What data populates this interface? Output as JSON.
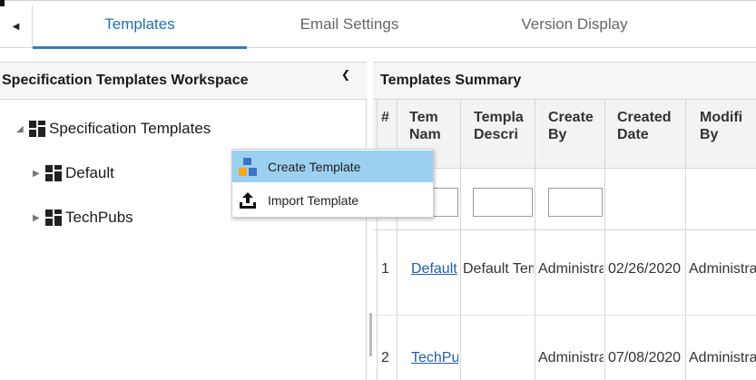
{
  "tabs": [
    {
      "label": "Templates",
      "active": true
    },
    {
      "label": "Email Settings",
      "active": false
    },
    {
      "label": "Version Display",
      "active": false
    }
  ],
  "left_panel": {
    "title": "Specification Templates Workspace",
    "tree": {
      "root": {
        "label": "Specification Templates",
        "expanded": true
      },
      "children": [
        {
          "label": "Default",
          "expanded": false
        },
        {
          "label": "TechPubs",
          "expanded": false
        }
      ]
    }
  },
  "context_menu": {
    "items": [
      {
        "label": "Create Template",
        "icon": "create-template-icon",
        "highlighted": true
      },
      {
        "label": "Import Template",
        "icon": "import-icon",
        "highlighted": false
      }
    ]
  },
  "right_panel": {
    "title": "Templates Summary",
    "columns": [
      {
        "line1": "#",
        "line2": ""
      },
      {
        "line1": "Tem",
        "line2": "Nam"
      },
      {
        "line1": "Templa",
        "line2": "Descri"
      },
      {
        "line1": "Create",
        "line2": "By"
      },
      {
        "line1": "Created",
        "line2": "Date"
      },
      {
        "line1": "Modifi",
        "line2": "By"
      }
    ],
    "rows": [
      {
        "num": "1",
        "name": "Default",
        "description": "Default Template",
        "created_by": "Administrator",
        "created_date": "02/26/2020",
        "modified_by": "Administrator"
      },
      {
        "num": "2",
        "name": "TechPubs",
        "description": "",
        "created_by": "Administrator",
        "created_date": "07/08/2020",
        "modified_by": "Administrator"
      }
    ]
  },
  "colors": {
    "accent": "#1f6fb3",
    "menu_highlight": "#9bd0f0",
    "link": "#1f5fb0"
  }
}
